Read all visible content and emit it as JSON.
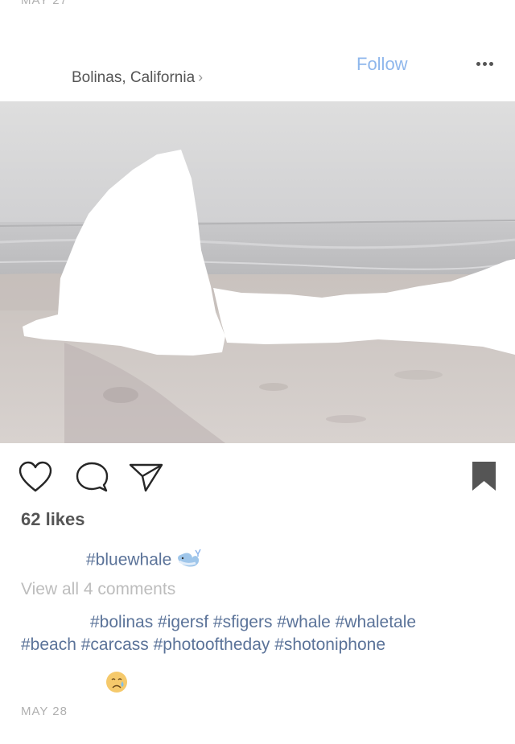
{
  "previous_post": {
    "date": "MAY 27"
  },
  "header": {
    "location": "Bolinas, California",
    "location_chevron": "›",
    "follow_label": "Follow",
    "more_icon": "more-horizontal-icon"
  },
  "post": {
    "likes": "62 likes",
    "caption": {
      "text": "#bluewhale",
      "emoji": "whale-emoji"
    },
    "view_comments": "View all 4 comments",
    "comment": {
      "line1": "#bolinas #igersf #sfigers #whale #whaletale",
      "line2": "#beach #carcass #photooftheday #shotoniphone",
      "emoji": "crying-face-emoji"
    },
    "date": "MAY 28"
  },
  "actions": [
    "heart-icon",
    "comment-icon",
    "share-icon",
    "bookmark-icon"
  ],
  "colors": {
    "follow": "#8fb7ec",
    "hashtag": "#5b7399",
    "muted": "#bdbdbd",
    "sky": "#d6d6d6",
    "sea": "#c2c2c4",
    "sand": "#cdc6c3"
  }
}
